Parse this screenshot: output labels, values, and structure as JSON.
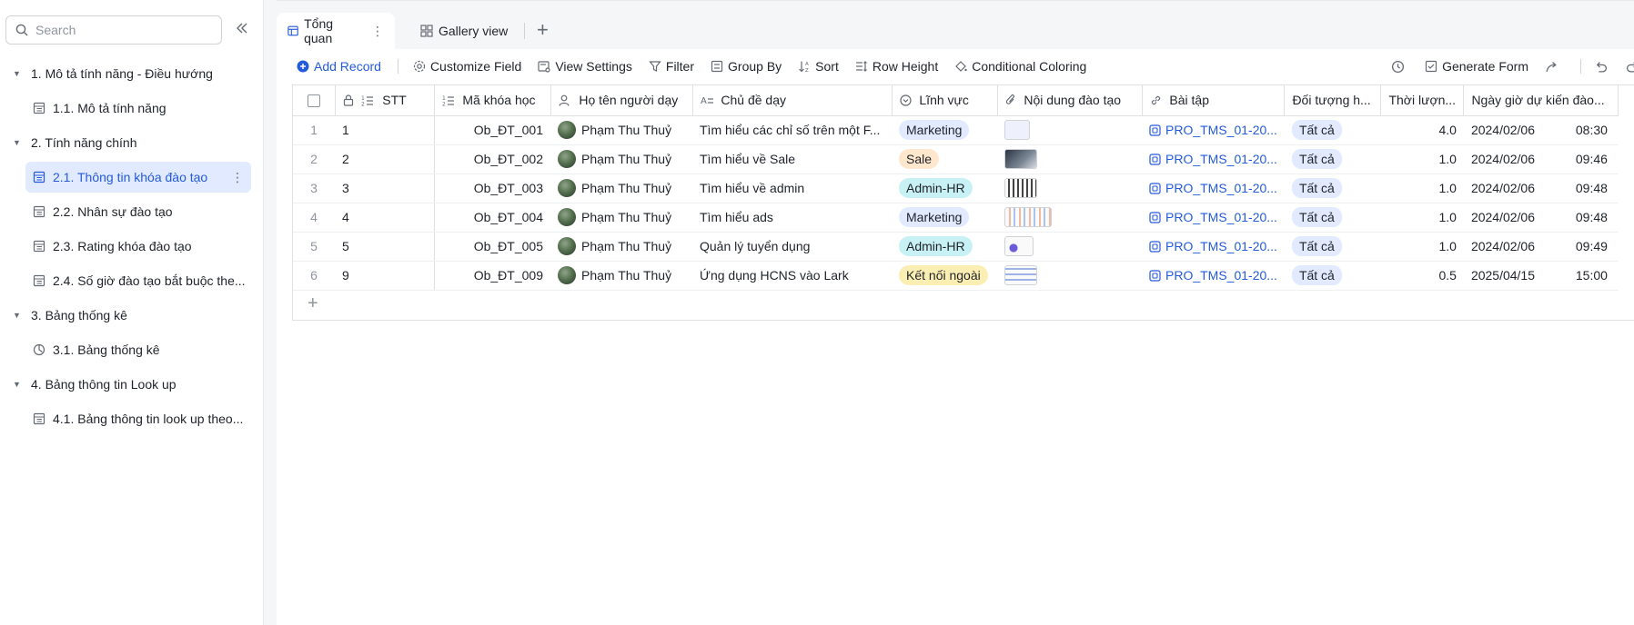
{
  "sidebar": {
    "search_placeholder": "Search",
    "items": [
      {
        "type": "group",
        "label": "1. Mô tả tính năng - Điều hướng"
      },
      {
        "type": "child",
        "icon": "table-icon",
        "label": "1.1. Mô tả tính năng"
      },
      {
        "type": "group",
        "label": "2. Tính năng chính"
      },
      {
        "type": "child",
        "icon": "table-icon",
        "label": "2.1. Thông tin khóa đào tạo",
        "active": true
      },
      {
        "type": "child",
        "icon": "table-icon",
        "label": "2.2. Nhân sự đào tạo"
      },
      {
        "type": "child",
        "icon": "table-icon",
        "label": "2.3. Rating khóa đào tạo"
      },
      {
        "type": "child",
        "icon": "table-icon",
        "label": "2.4. Số giờ đào tạo bắt buộc the..."
      },
      {
        "type": "group",
        "label": "3. Bảng thống kê"
      },
      {
        "type": "child",
        "icon": "dashboard-icon",
        "label": "3.1. Bảng thống kê"
      },
      {
        "type": "group",
        "label": "4. Bảng thông tin Look up"
      },
      {
        "type": "child",
        "icon": "table-icon",
        "label": "4.1. Bảng thông tin look up theo..."
      }
    ]
  },
  "tabs": [
    {
      "label": "Tổng quan",
      "active": true
    },
    {
      "label": "Gallery view",
      "active": false
    }
  ],
  "toolbar": {
    "add_record": "Add Record",
    "customize_field": "Customize Field",
    "view_settings": "View Settings",
    "filter": "Filter",
    "group_by": "Group By",
    "sort": "Sort",
    "row_height": "Row Height",
    "conditional_coloring": "Conditional Coloring",
    "generate_form": "Generate Form"
  },
  "columns": [
    "STT",
    "Mã khóa học",
    "Họ tên người dạy",
    "Chủ đề dạy",
    "Lĩnh vực",
    "Nội dung đào tạo",
    "Bài tập",
    "Đối tượng h...",
    "Thời lượn...",
    "Ngày giờ dự kiến đào..."
  ],
  "rows": [
    {
      "num": "1",
      "stt": "1",
      "code": "Ob_ĐT_001",
      "teacher": "Phạm Thu Thuỷ",
      "topic": "Tìm hiểu các chỉ số trên một F...",
      "field": "Marketing",
      "field_color": "#e1eaff",
      "homework": "PRO_TMS_01-20...",
      "target": "Tất cả",
      "duration": "4.0",
      "date": "2024/02/06",
      "time": "08:30"
    },
    {
      "num": "2",
      "stt": "2",
      "code": "Ob_ĐT_002",
      "teacher": "Phạm Thu Thuỷ",
      "topic": "Tìm hiểu về Sale",
      "field": "Sale",
      "field_color": "#fee7cd",
      "homework": "PRO_TMS_01-20...",
      "target": "Tất cả",
      "duration": "1.0",
      "date": "2024/02/06",
      "time": "09:46"
    },
    {
      "num": "3",
      "stt": "3",
      "code": "Ob_ĐT_003",
      "teacher": "Phạm Thu Thuỷ",
      "topic": "Tìm hiểu về admin",
      "field": "Admin-HR",
      "field_color": "#c8f1f5",
      "homework": "PRO_TMS_01-20...",
      "target": "Tất cả",
      "duration": "1.0",
      "date": "2024/02/06",
      "time": "09:48"
    },
    {
      "num": "4",
      "stt": "4",
      "code": "Ob_ĐT_004",
      "teacher": "Phạm Thu Thuỷ",
      "topic": "Tìm hiểu ads",
      "field": "Marketing",
      "field_color": "#e1eaff",
      "homework": "PRO_TMS_01-20...",
      "target": "Tất cả",
      "duration": "1.0",
      "date": "2024/02/06",
      "time": "09:48"
    },
    {
      "num": "5",
      "stt": "5",
      "code": "Ob_ĐT_005",
      "teacher": "Phạm Thu Thuỷ",
      "topic": "Quản lý tuyển dụng",
      "field": "Admin-HR",
      "field_color": "#c8f1f5",
      "homework": "PRO_TMS_01-20...",
      "target": "Tất cả",
      "duration": "1.0",
      "date": "2024/02/06",
      "time": "09:49"
    },
    {
      "num": "6",
      "stt": "9",
      "code": "Ob_ĐT_009",
      "teacher": "Phạm Thu Thuỷ",
      "topic": "Ứng dụng HCNS vào Lark",
      "field": "Kết nối ngoài",
      "field_color": "#fbeeb3",
      "homework": "PRO_TMS_01-20...",
      "target": "Tất cả",
      "duration": "0.5",
      "date": "2025/04/15",
      "time": "15:00"
    }
  ]
}
